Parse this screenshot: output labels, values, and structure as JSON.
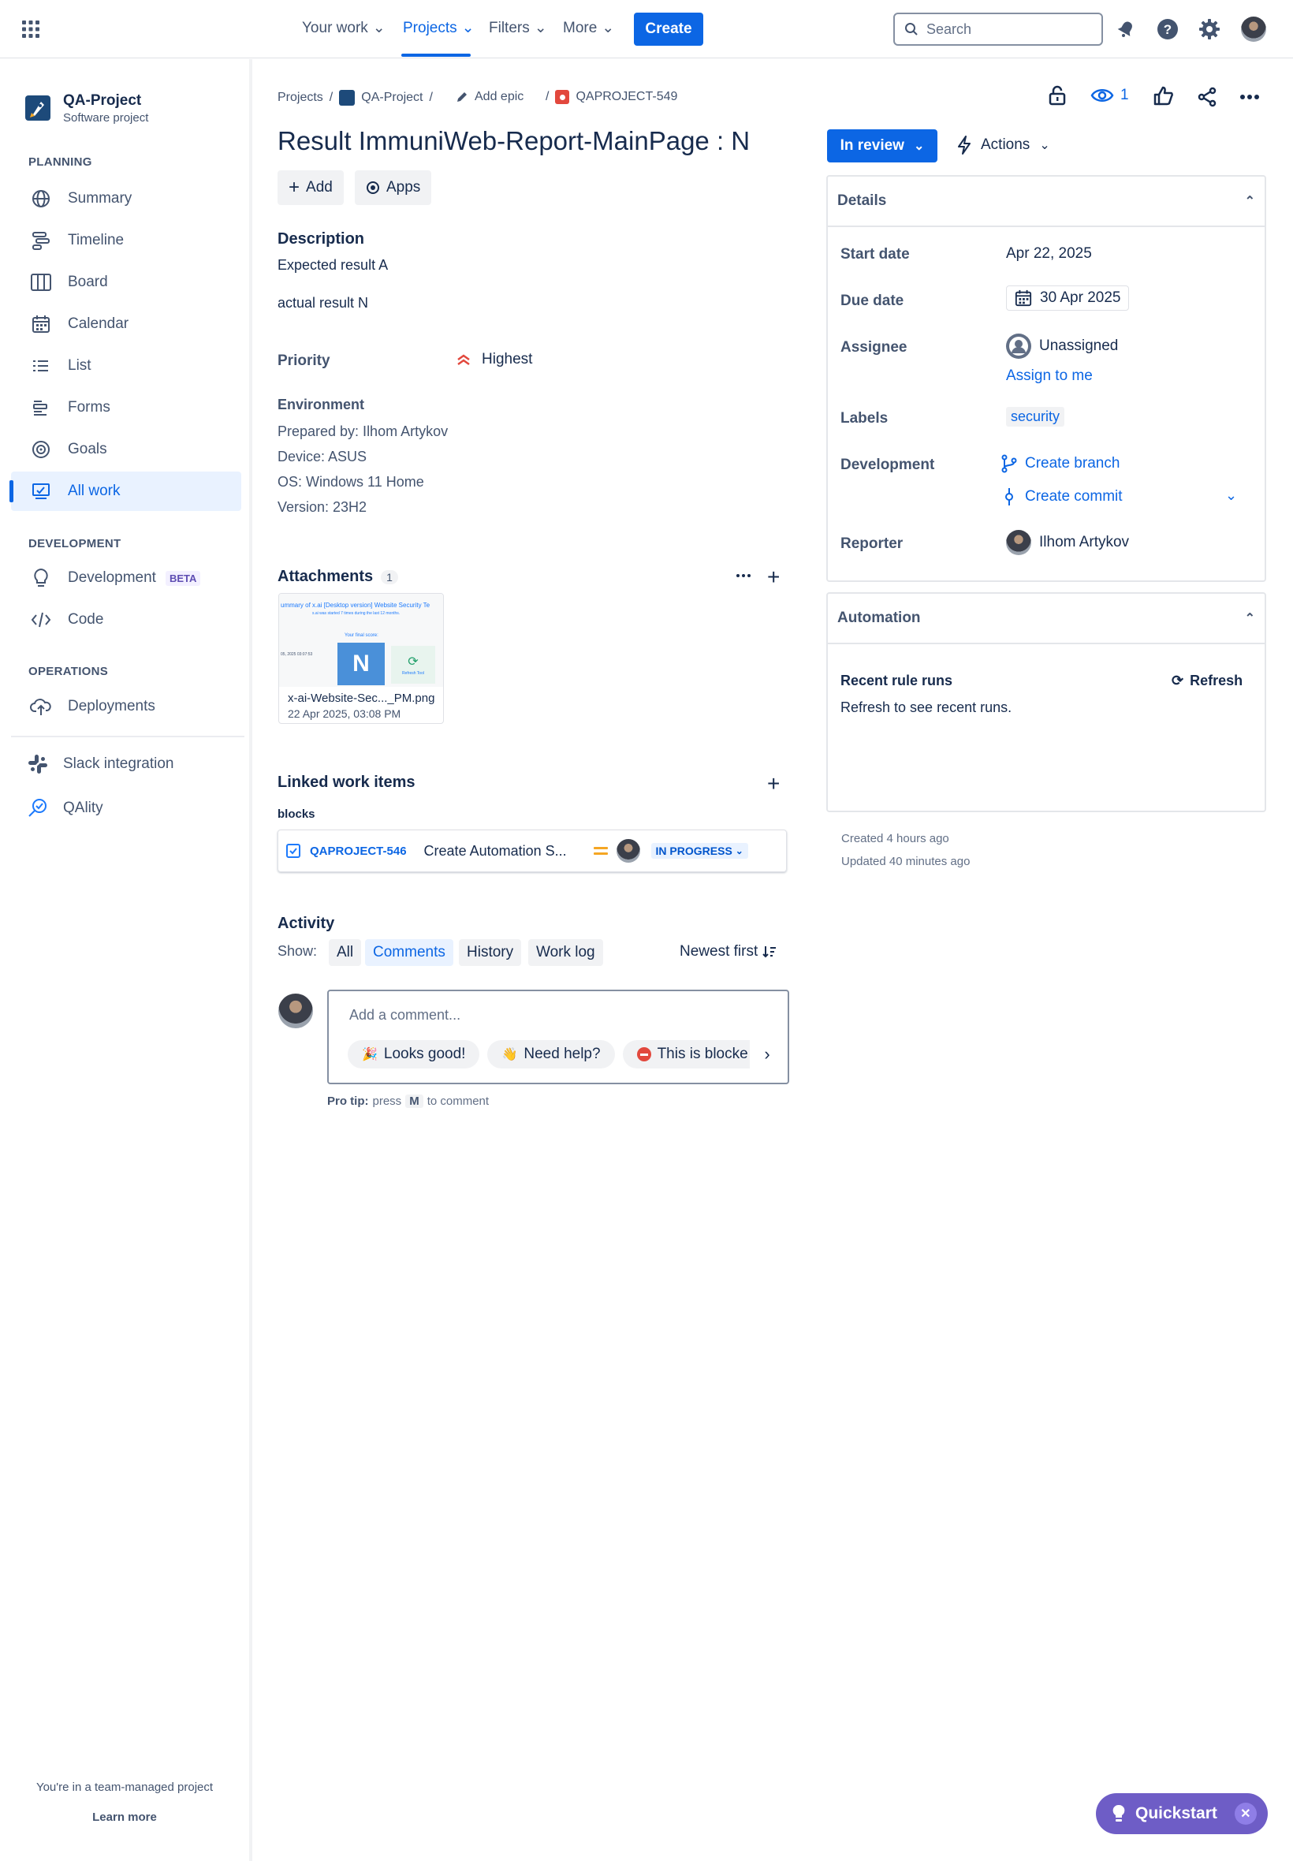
{
  "topnav": {
    "items": [
      "Your work",
      "Projects",
      "Filters",
      "More"
    ],
    "create_label": "Create",
    "search_placeholder": "Search"
  },
  "sidebar": {
    "project_name": "QA-Project",
    "project_type": "Software project",
    "planning_heading": "PLANNING",
    "planning_items": [
      "Summary",
      "Timeline",
      "Board",
      "Calendar",
      "List",
      "Forms",
      "Goals",
      "All work"
    ],
    "development_heading": "DEVELOPMENT",
    "development_items": [
      "Development",
      "Code"
    ],
    "beta_badge": "BETA",
    "operations_heading": "OPERATIONS",
    "operations_items": [
      "Deployments"
    ],
    "extra_items": [
      "Slack integration",
      "QAlity"
    ],
    "footer_text": "You're in a team-managed project",
    "footer_link": "Learn more"
  },
  "breadcrumb": {
    "projects": "Projects",
    "project": "QA-Project",
    "add_epic": "Add epic",
    "issue_key": "QAPROJECT-549",
    "sep": "/"
  },
  "issue": {
    "title": "Result ImmuniWeb-Report-MainPage : N",
    "add_label": "Add",
    "apps_label": "Apps",
    "description_heading": "Description",
    "description_lines": [
      "Expected result A",
      "actual result N"
    ],
    "priority_label": "Priority",
    "priority_value": "Highest",
    "environment_label": "Environment",
    "environment_lines": [
      "Prepared by: Ilhom Artykov",
      "Device: ASUS",
      "OS: Windows 11 Home",
      "Version: 23H2"
    ],
    "watchers_count": "1"
  },
  "attachments": {
    "heading": "Attachments",
    "count": "1",
    "file_name": "x-ai-Website-Sec..._PM.png",
    "file_date": "22 Apr 2025, 03:08 PM",
    "thumb_text": "ummary of x.ai [Desktop version] Website Security Te",
    "thumb_sub": "s.ai was started 7 times during the last 12 months.",
    "thumb_score_label": "Your final score:",
    "thumb_grade": "N",
    "thumb_date": "05, 2025 03:07:53",
    "thumb_refresh": "Refresh Tool"
  },
  "linked": {
    "heading": "Linked work items",
    "relation": "blocks",
    "key": "QAPROJECT-546",
    "summary": "Create Automation S...",
    "status": "IN PROGRESS"
  },
  "activity": {
    "heading": "Activity",
    "show_label": "Show:",
    "filters": [
      "All",
      "Comments",
      "History",
      "Work log"
    ],
    "sort_label": "Newest first",
    "comment_placeholder": "Add a comment...",
    "chips": [
      "Looks good!",
      "Need help?",
      "This is blocke"
    ],
    "pro_tip_bold": "Pro tip:",
    "pro_tip_press": "press",
    "pro_tip_key": "M",
    "pro_tip_rest": "to comment"
  },
  "status": {
    "label": "In review",
    "actions_label": "Actions"
  },
  "details": {
    "heading": "Details",
    "start_date_label": "Start date",
    "start_date_value": "Apr 22, 2025",
    "due_date_label": "Due date",
    "due_date_value": "30 Apr 2025",
    "assignee_label": "Assignee",
    "assignee_value": "Unassigned",
    "assign_to_me": "Assign to me",
    "labels_label": "Labels",
    "labels_value": "security",
    "development_label": "Development",
    "create_branch": "Create branch",
    "create_commit": "Create commit",
    "reporter_label": "Reporter",
    "reporter_value": "Ilhom Artykov"
  },
  "automation": {
    "heading": "Automation",
    "recent_runs": "Recent rule runs",
    "refresh_label": "Refresh",
    "refresh_hint": "Refresh to see recent runs."
  },
  "meta": {
    "created": "Created 4 hours ago",
    "updated": "Updated 40 minutes ago"
  },
  "quickstart": {
    "label": "Quickstart"
  },
  "colors": {
    "accent": "#0c66e4",
    "priority": "#e2483d",
    "medium_priority": "#f5a623",
    "beta_bg": "#f3f0ff"
  }
}
